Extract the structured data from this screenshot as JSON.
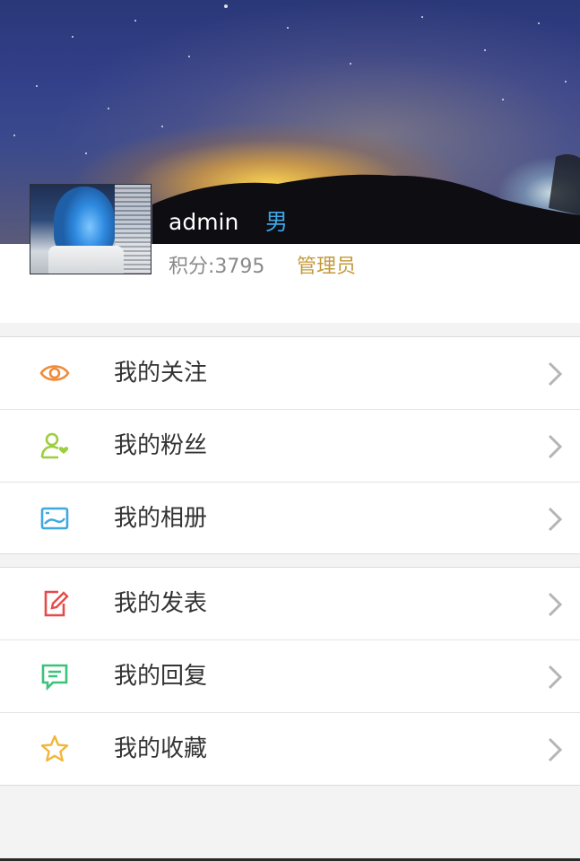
{
  "profile": {
    "username": "admin",
    "gender": "男",
    "points": "积分:3795",
    "role": "管理员"
  },
  "menu": {
    "group1": [
      {
        "label": "我的关注",
        "icon": "eye-icon",
        "color": "#f08a35"
      },
      {
        "label": "我的粉丝",
        "icon": "user-heart-icon",
        "color": "#9bcf3c"
      },
      {
        "label": "我的相册",
        "icon": "image-icon",
        "color": "#3ea8e0"
      }
    ],
    "group2": [
      {
        "label": "我的发表",
        "icon": "edit-icon",
        "color": "#e64a4a"
      },
      {
        "label": "我的回复",
        "icon": "comment-icon",
        "color": "#3cc27a"
      },
      {
        "label": "我的收藏",
        "icon": "star-icon",
        "color": "#f2b63a"
      }
    ]
  },
  "colors": {
    "background": "#f3f3f3",
    "chevron": "#b5b5b5",
    "gender": "#3fa6e6",
    "role": "#c49a3c"
  }
}
